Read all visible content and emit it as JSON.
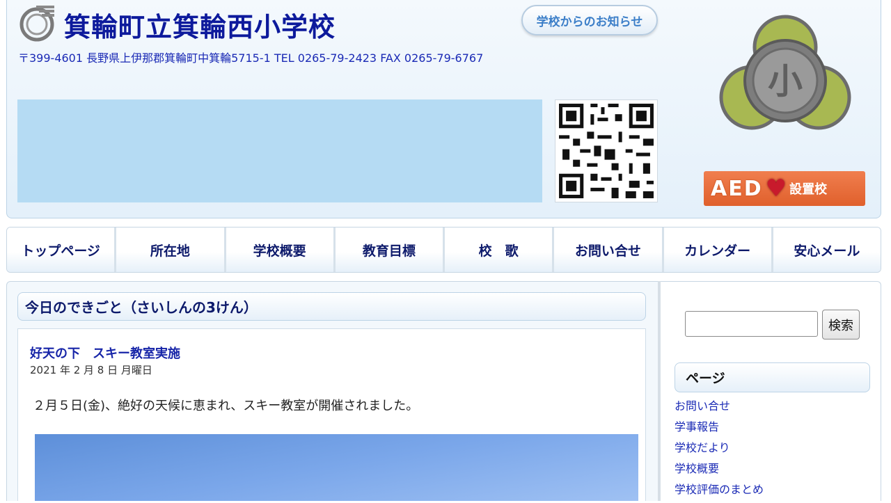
{
  "header": {
    "school_name": "箕輪町立箕輪西小学校",
    "address": "〒399-4601 長野県上伊那郡箕輪町中箕輪5715-1 TEL 0265-79-2423 FAX 0265-79-6767",
    "notice_button": "学校からのお知らせ",
    "emblem_char": "小",
    "aed_text": "AED",
    "aed_label": "設置校"
  },
  "nav": {
    "items": [
      "トップページ",
      "所在地",
      "学校概要",
      "教育目標",
      "校　歌",
      "お問い合せ",
      "カレンダー",
      "安心メール"
    ]
  },
  "main": {
    "section_title": "今日のできごと（さいしんの3けん）",
    "post": {
      "title": "好天の下　スキー教室実施",
      "date": "2021 年 2 月 8 日 月曜日",
      "body": "２月５日(金)、絶好の天候に恵まれ、スキー教室が開催されました。"
    }
  },
  "sidebar": {
    "search_button": "検索",
    "pages_heading": "ページ",
    "links": [
      "お問い合せ",
      "学事報告",
      "学校だより",
      "学校概要",
      "学校評価のまとめ"
    ]
  },
  "colors": {
    "title_blue": "#0d1a9c",
    "link_blue": "#1a2ab5",
    "banner": "#b5dbf3",
    "aed": "#e8683a"
  }
}
